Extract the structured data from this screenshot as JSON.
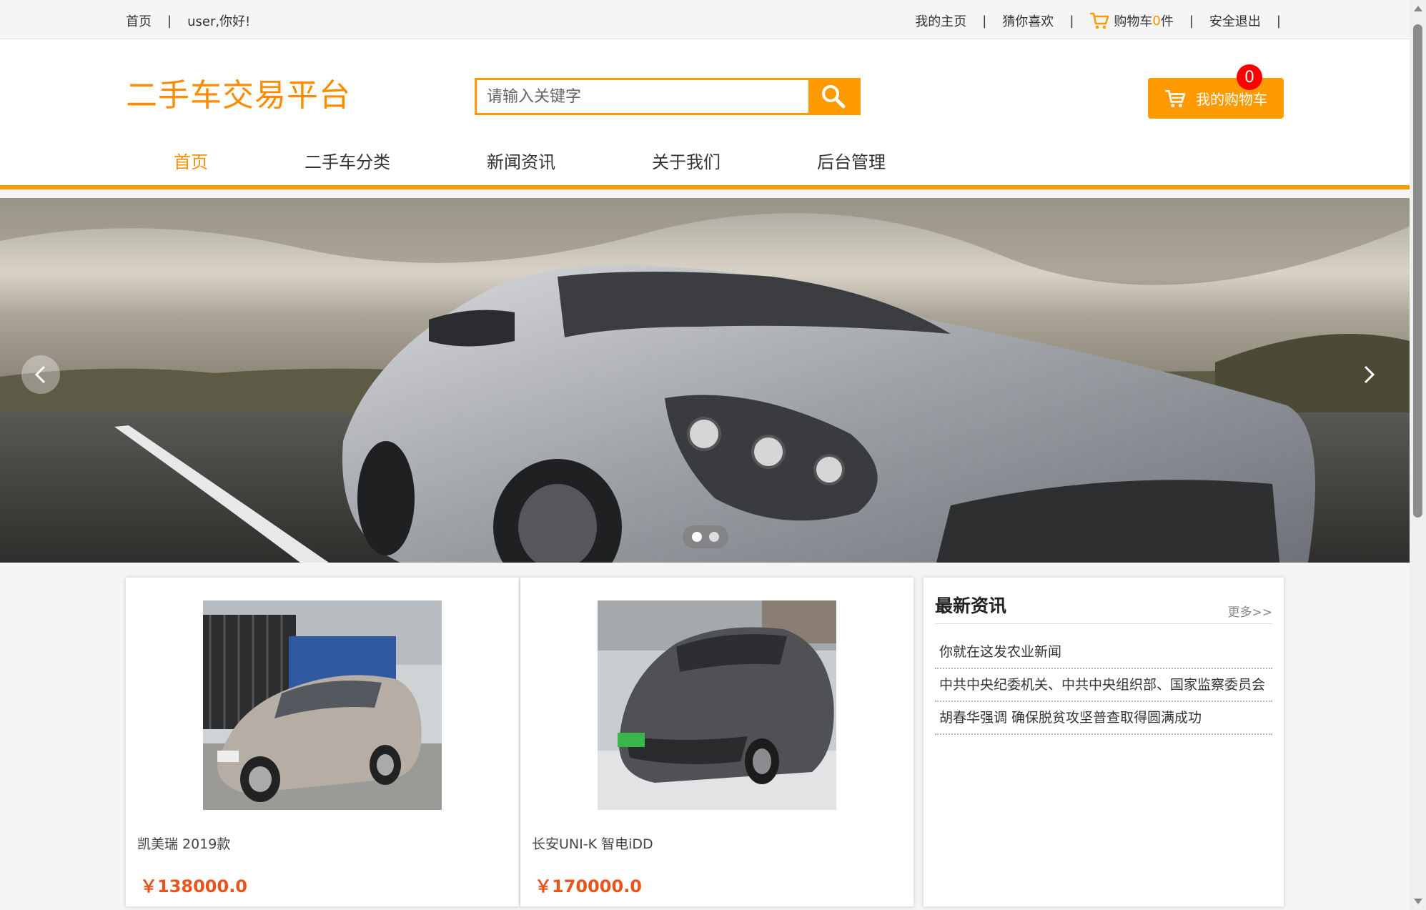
{
  "topbar": {
    "home": "首页",
    "greeting": "user,你好!",
    "sep": "|",
    "my_home": "我的主页",
    "guess_like": "猜你喜欢",
    "cart_prefix": "购物车",
    "cart_count": "0",
    "cart_suffix": "件",
    "logout": "安全退出"
  },
  "header": {
    "logo": "二手车交易平台",
    "search_placeholder": "请输入关键字",
    "mycart_label": "我的购物车",
    "cart_badge": "0"
  },
  "nav": {
    "items": [
      {
        "label": "首页",
        "active": true
      },
      {
        "label": "二手车分类",
        "active": false
      },
      {
        "label": "新闻资讯",
        "active": false
      },
      {
        "label": "关于我们",
        "active": false
      },
      {
        "label": "后台管理",
        "active": false
      }
    ]
  },
  "banner": {
    "slide_count": 2,
    "active_slide": 0
  },
  "products": [
    {
      "name": "凯美瑞 2019款",
      "price": "￥138000.0"
    },
    {
      "name": "长安UNI-K 智电iDD",
      "price": "￥170000.0"
    }
  ],
  "news": {
    "title": "最新资讯",
    "more": "更多>>",
    "items": [
      "你就在这发农业新闻",
      "中共中央纪委机关、中共中央组织部、国家监察委员会",
      "胡春华强调 确保脱贫攻坚普查取得圆满成功"
    ]
  },
  "colors": {
    "accent": "#ff9a00",
    "price": "#e8541c",
    "badge": "#ff0000"
  },
  "icons": {
    "search": "search-icon",
    "cart": "cart-icon",
    "prev": "chevron-left-icon",
    "next": "chevron-right-icon"
  }
}
